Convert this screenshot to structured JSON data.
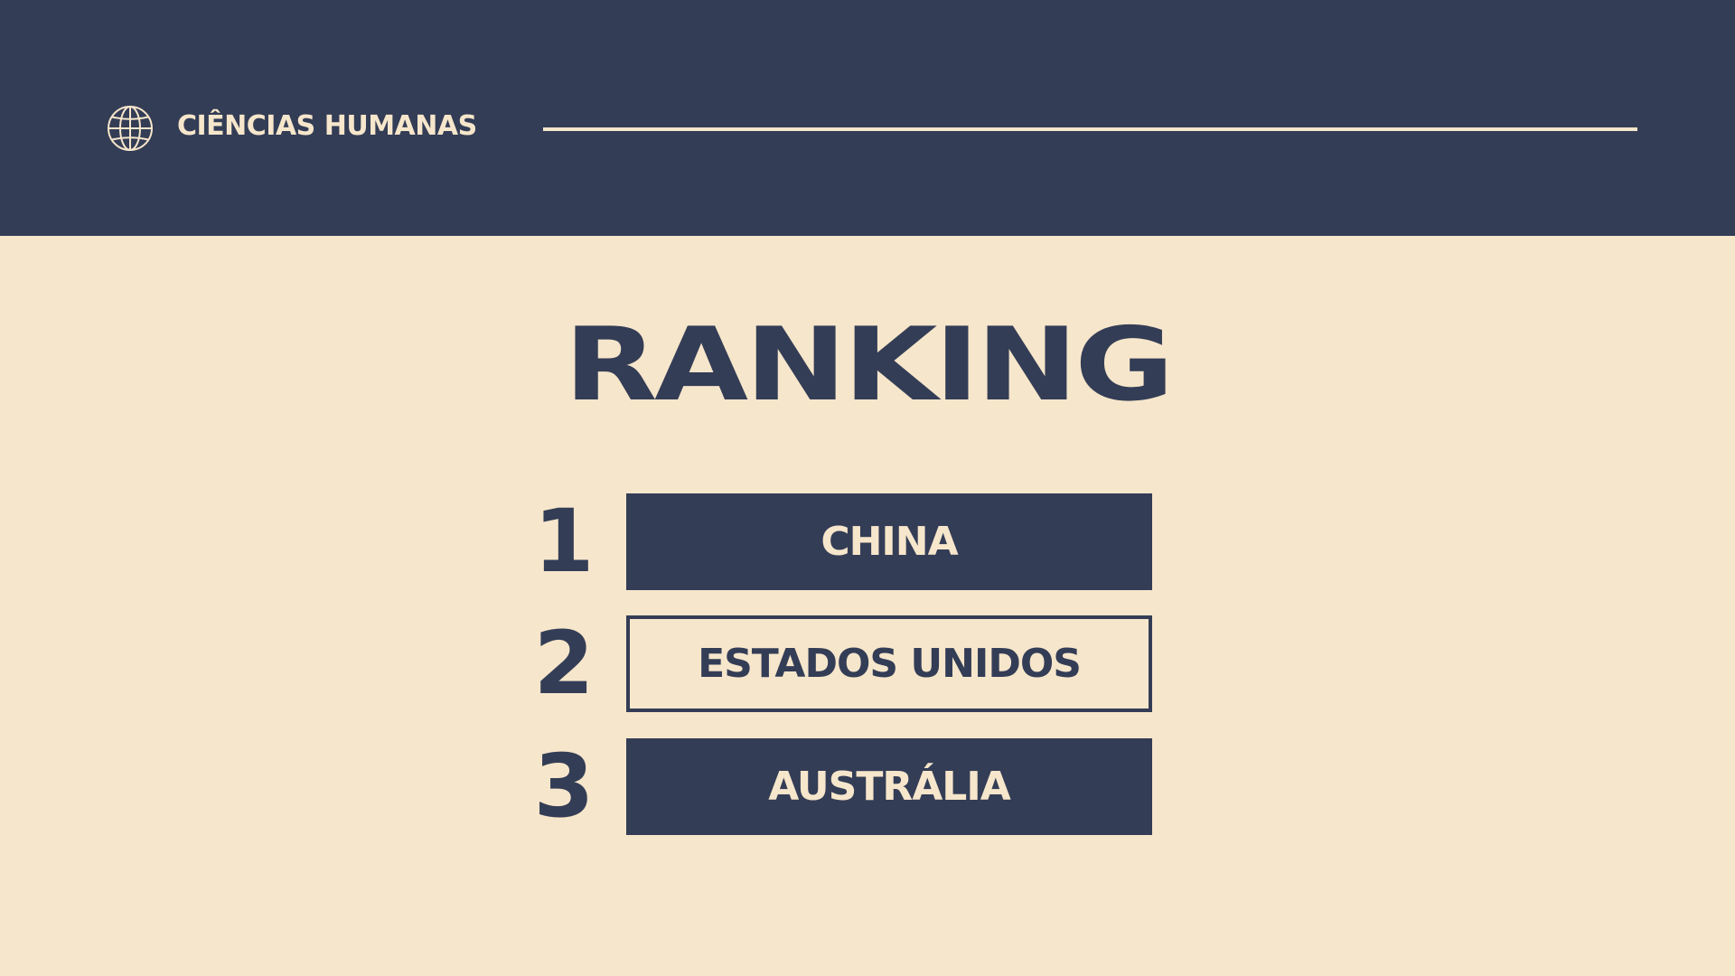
{
  "header": {
    "subject": "CIÊNCIAS HUMANAS",
    "icon": "globe-icon"
  },
  "title": "RANKING",
  "ranking": [
    {
      "position": "1",
      "country": "CHINA",
      "style": "filled"
    },
    {
      "position": "2",
      "country": "ESTADOS UNIDOS",
      "style": "outlined"
    },
    {
      "position": "3",
      "country": "AUSTRÁLIA",
      "style": "filled"
    }
  ],
  "colors": {
    "navy": "#343D56",
    "cream": "#F6E6CB"
  }
}
